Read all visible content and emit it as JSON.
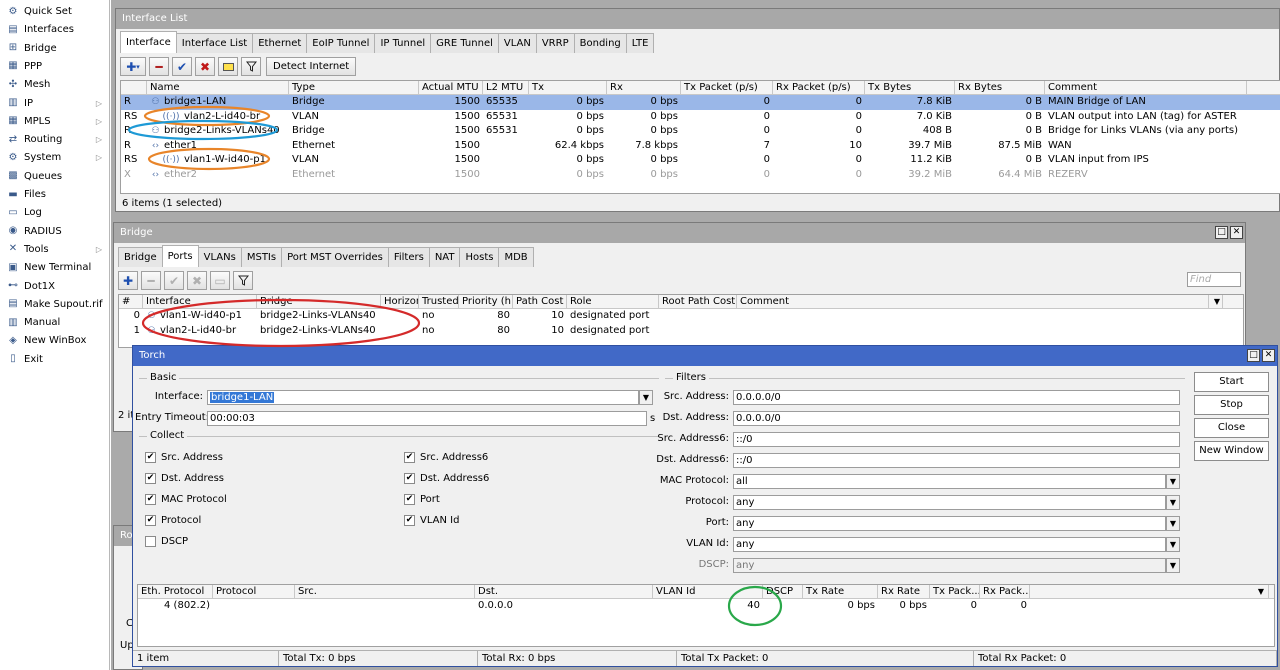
{
  "sidebar": {
    "items": [
      {
        "label": "Quick Set",
        "icon": "quick-set-icon",
        "arrow": false
      },
      {
        "label": "Interfaces",
        "icon": "interfaces-icon",
        "arrow": false
      },
      {
        "label": "Bridge",
        "icon": "bridge-icon",
        "arrow": false
      },
      {
        "label": "PPP",
        "icon": "ppp-icon",
        "arrow": false
      },
      {
        "label": "Mesh",
        "icon": "mesh-icon",
        "arrow": false
      },
      {
        "label": "IP",
        "icon": "ip-icon",
        "arrow": true
      },
      {
        "label": "MPLS",
        "icon": "mpls-icon",
        "arrow": true
      },
      {
        "label": "Routing",
        "icon": "routing-icon",
        "arrow": true
      },
      {
        "label": "System",
        "icon": "system-icon",
        "arrow": true
      },
      {
        "label": "Queues",
        "icon": "queues-icon",
        "arrow": false
      },
      {
        "label": "Files",
        "icon": "files-icon",
        "arrow": false
      },
      {
        "label": "Log",
        "icon": "log-icon",
        "arrow": false
      },
      {
        "label": "RADIUS",
        "icon": "radius-icon",
        "arrow": false
      },
      {
        "label": "Tools",
        "icon": "tools-icon",
        "arrow": true
      },
      {
        "label": "New Terminal",
        "icon": "terminal-icon",
        "arrow": false
      },
      {
        "label": "Dot1X",
        "icon": "dot1x-icon",
        "arrow": false
      },
      {
        "label": "Make Supout.rif",
        "icon": "supout-icon",
        "arrow": false
      },
      {
        "label": "Manual",
        "icon": "manual-icon",
        "arrow": false
      },
      {
        "label": "New WinBox",
        "icon": "winbox-icon",
        "arrow": false
      },
      {
        "label": "Exit",
        "icon": "exit-icon",
        "arrow": false
      }
    ]
  },
  "interface_window": {
    "title": "Interface List",
    "tabs": [
      "Interface",
      "Interface List",
      "Ethernet",
      "EoIP Tunnel",
      "IP Tunnel",
      "GRE Tunnel",
      "VLAN",
      "VRRP",
      "Bonding",
      "LTE"
    ],
    "detect_button": "Detect Internet",
    "columns": [
      "",
      "Name",
      "Type",
      "Actual MTU",
      "L2 MTU",
      "Tx",
      "Rx",
      "Tx Packet (p/s)",
      "Rx Packet (p/s)",
      "Tx Bytes",
      "Rx Bytes",
      "Comment"
    ],
    "rows": [
      {
        "flag": "R",
        "name": "bridge1-LAN",
        "type": "Bridge",
        "mtu": "1500",
        "l2mtu": "65535",
        "tx": "0 bps",
        "rx": "0 bps",
        "txp": "0",
        "rxp": "0",
        "txb": "7.8 KiB",
        "rxb": "0 B",
        "comment": "MAIN Bridge of LAN",
        "selected": true,
        "disabled": false
      },
      {
        "flag": "RS",
        "name": "vlan2-L-id40-br",
        "type": "VLAN",
        "mtu": "1500",
        "l2mtu": "65531",
        "tx": "0 bps",
        "rx": "0 bps",
        "txp": "0",
        "rxp": "0",
        "txb": "7.0 KiB",
        "rxb": "0 B",
        "comment": "VLAN output into LAN (tag) for ASTER",
        "selected": false,
        "disabled": false
      },
      {
        "flag": "R",
        "name": "bridge2-Links-VLANs40",
        "type": "Bridge",
        "mtu": "1500",
        "l2mtu": "65531",
        "tx": "0 bps",
        "rx": "0 bps",
        "txp": "0",
        "rxp": "0",
        "txb": "408 B",
        "rxb": "0 B",
        "comment": "Bridge for Links VLANs (via any ports)",
        "selected": false,
        "disabled": false
      },
      {
        "flag": "R",
        "name": "ether1",
        "type": "Ethernet",
        "mtu": "1500",
        "l2mtu": "",
        "tx": "62.4 kbps",
        "rx": "7.8 kbps",
        "txp": "7",
        "rxp": "10",
        "txb": "39.7 MiB",
        "rxb": "87.5 MiB",
        "comment": "WAN",
        "selected": false,
        "disabled": false
      },
      {
        "flag": "RS",
        "name": "vlan1-W-id40-p1",
        "type": "VLAN",
        "mtu": "1500",
        "l2mtu": "",
        "tx": "0 bps",
        "rx": "0 bps",
        "txp": "0",
        "rxp": "0",
        "txb": "11.2 KiB",
        "rxb": "0 B",
        "comment": "VLAN input from IPS",
        "selected": false,
        "disabled": false
      },
      {
        "flag": "X",
        "name": "ether2",
        "type": "Ethernet",
        "mtu": "1500",
        "l2mtu": "",
        "tx": "0 bps",
        "rx": "0 bps",
        "txp": "0",
        "rxp": "0",
        "txb": "39.2 MiB",
        "rxb": "64.4 MiB",
        "comment": "REZERV",
        "selected": false,
        "disabled": true
      }
    ],
    "status": "6 items (1 selected)"
  },
  "bridge_window": {
    "title": "Bridge",
    "tabs": [
      "Bridge",
      "Ports",
      "VLANs",
      "MSTIs",
      "Port MST Overrides",
      "Filters",
      "NAT",
      "Hosts",
      "MDB"
    ],
    "find_placeholder": "Find",
    "columns": [
      "#",
      "Interface",
      "Bridge",
      "Horizon",
      "Trusted",
      "Priority (h...",
      "Path Cost",
      "Role",
      "Root Path Cost",
      "Comment"
    ],
    "rows": [
      {
        "num": "0",
        "iface": "vlan1-W-id40-p1",
        "bridge": "bridge2-Links-VLANs40",
        "horizon": "",
        "trusted": "no",
        "priority": "80",
        "cost": "10",
        "role": "designated port"
      },
      {
        "num": "1",
        "iface": "vlan2-L-id40-br",
        "bridge": "bridge2-Links-VLANs40",
        "horizon": "",
        "trusted": "no",
        "priority": "80",
        "cost": "10",
        "role": "designated port"
      }
    ],
    "status_partial": "2 it"
  },
  "torch_window": {
    "title": "Torch",
    "basic_label": "Basic",
    "interface_label": "Interface:",
    "interface_value": "bridge1-LAN",
    "entry_timeout_label": "Entry Timeout:",
    "entry_timeout_value": "00:00:03",
    "entry_timeout_unit": "s",
    "collect_label": "Collect",
    "collect_left": [
      {
        "label": "Src. Address",
        "checked": true
      },
      {
        "label": "Dst. Address",
        "checked": true
      },
      {
        "label": "MAC Protocol",
        "checked": true
      },
      {
        "label": "Protocol",
        "checked": true
      },
      {
        "label": "DSCP",
        "checked": false
      }
    ],
    "collect_right": [
      {
        "label": "Src. Address6",
        "checked": true
      },
      {
        "label": "Dst. Address6",
        "checked": true
      },
      {
        "label": "Port",
        "checked": true
      },
      {
        "label": "VLAN Id",
        "checked": true
      }
    ],
    "filters_label": "Filters",
    "filters": [
      {
        "label": "Src. Address:",
        "value": "0.0.0.0/0",
        "dropdown": false,
        "disabled": false
      },
      {
        "label": "Dst. Address:",
        "value": "0.0.0.0/0",
        "dropdown": false,
        "disabled": false
      },
      {
        "label": "Src. Address6:",
        "value": "::/0",
        "dropdown": false,
        "disabled": false
      },
      {
        "label": "Dst. Address6:",
        "value": "::/0",
        "dropdown": false,
        "disabled": false
      },
      {
        "label": "MAC Protocol:",
        "value": "all",
        "dropdown": true,
        "disabled": false
      },
      {
        "label": "Protocol:",
        "value": "any",
        "dropdown": true,
        "disabled": false
      },
      {
        "label": "Port:",
        "value": "any",
        "dropdown": true,
        "disabled": false
      },
      {
        "label": "VLAN Id:",
        "value": "any",
        "dropdown": true,
        "disabled": false
      },
      {
        "label": "DSCP:",
        "value": "any",
        "dropdown": true,
        "disabled": true
      }
    ],
    "buttons": [
      "Start",
      "Stop",
      "Close",
      "New Window"
    ],
    "result_columns": [
      "Eth. Protocol",
      "Protocol",
      "Src.",
      "Dst.",
      "VLAN Id",
      "DSCP",
      "Tx Rate",
      "Rx Rate",
      "Tx Pack...",
      "Rx Pack..."
    ],
    "result_rows": [
      {
        "eth": "4 (802.2)",
        "proto": "",
        "src": "",
        "dst": "0.0.0.0",
        "vlan": "40",
        "dscp": "",
        "txrate": "0 bps",
        "rxrate": "0 bps",
        "txp": "0",
        "rxp": "0"
      }
    ],
    "status": [
      "1 item",
      "Total Tx: 0 bps",
      "Total Rx: 0 bps",
      "Total Tx Packet: 0",
      "Total Rx Packet: 0"
    ]
  },
  "background_window_partial": {
    "title": "Ro",
    "labels": [
      "C",
      "Up"
    ]
  },
  "highlights": {
    "orange": "#e8852a",
    "blue": "#1e9ad6",
    "red": "#d42a2a",
    "green": "#2aa84a"
  }
}
